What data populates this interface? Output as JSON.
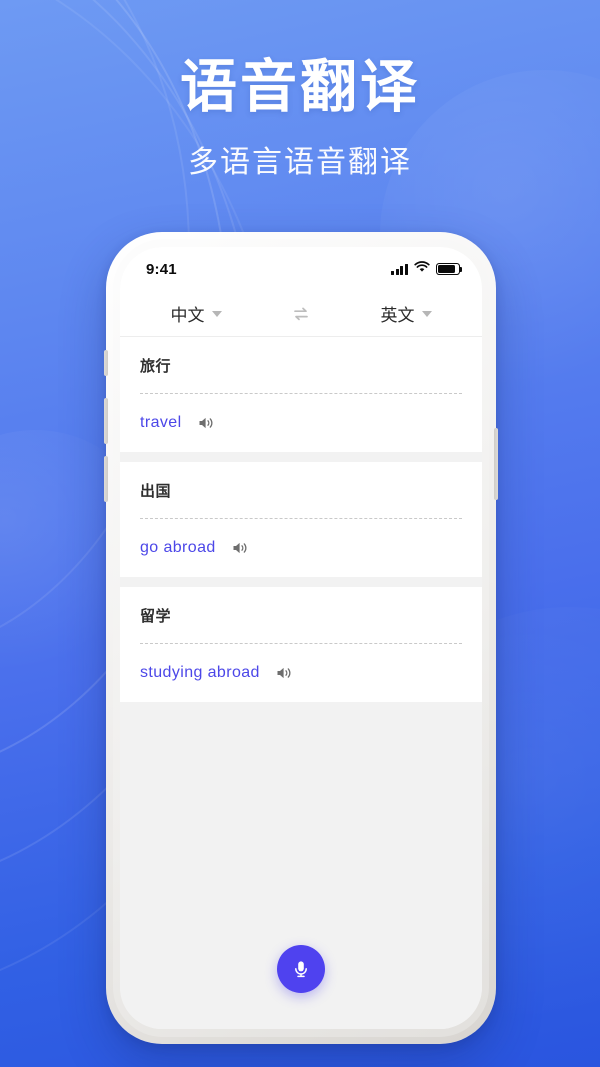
{
  "header": {
    "title": "语音翻译",
    "subtitle": "多语言语音翻译"
  },
  "colors": {
    "bg_top": "#6e9af3",
    "bg_bottom": "#2a55df",
    "accent": "#4f42ef",
    "translation_text": "#4c47e8",
    "source_text": "#2f2f2f",
    "screen_bg": "#f2f2f2"
  },
  "phone": {
    "status_bar": {
      "time": "9:41",
      "signal_icon": "signal-bars-icon",
      "wifi_icon": "wifi-icon",
      "battery_icon": "battery-icon"
    },
    "language_bar": {
      "source_language": "中文",
      "target_language": "英文",
      "source_caret_icon": "chevron-down-icon",
      "target_caret_icon": "chevron-down-icon",
      "swap_icon": "swap-arrows-icon"
    },
    "translations": [
      {
        "source": "旅行",
        "target": "travel",
        "speaker_icon": "speaker-icon"
      },
      {
        "source": "出国",
        "target": "go abroad",
        "speaker_icon": "speaker-icon"
      },
      {
        "source": "留学",
        "target": "studying abroad",
        "speaker_icon": "speaker-icon"
      }
    ],
    "mic_button": {
      "icon": "microphone-icon"
    }
  }
}
